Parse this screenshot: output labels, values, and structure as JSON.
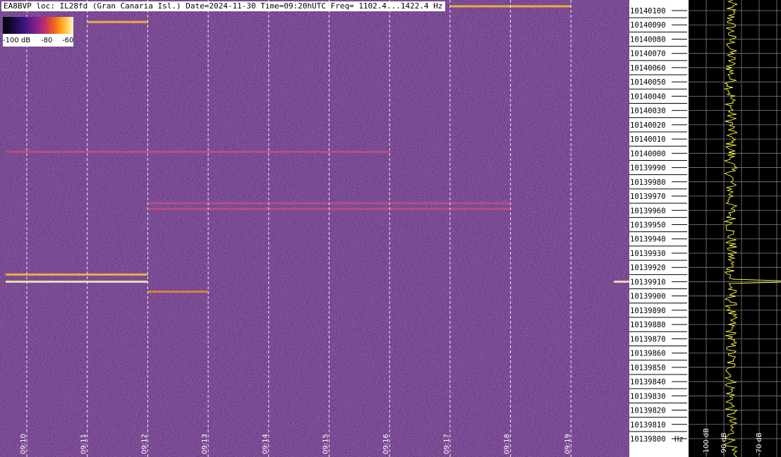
{
  "header": {
    "text": "EA8BVP loc: IL28fd (Gran Canaria Isl.) Date=2024-11-30 Time=09:20hUTC Freq= 1102.4...1422.4 Hz"
  },
  "colorbar": {
    "labels": [
      "-100 dB",
      "-80",
      "-60"
    ]
  },
  "chart_data": {
    "type": "heatmap",
    "title": "",
    "x": [
      "09:10",
      "09:11",
      "09:12",
      "09:13",
      "09:14",
      "09:15",
      "09:16",
      "09:17",
      "09:18",
      "09:19"
    ],
    "y_ticks": [
      10140100,
      10140090,
      10140080,
      10140070,
      10140060,
      10140050,
      10140040,
      10140030,
      10140020,
      10140010,
      10140000,
      10139990,
      10139980,
      10139970,
      10139960,
      10139950,
      10139940,
      10139930,
      10139920,
      10139910,
      10139900,
      10139890,
      10139880,
      10139870,
      10139860,
      10139850,
      10139840,
      10139830,
      10139820,
      10139810,
      10139800
    ],
    "y_unit": "Hz",
    "ylim": [
      10139795,
      10140103
    ],
    "color_range_db": [
      -100,
      -60
    ],
    "grid": true,
    "signals": [
      {
        "freq": 10140001,
        "t_start": "09:10",
        "t_end": "09:16",
        "level_db": -78
      },
      {
        "freq": 10139965,
        "t_start": "09:12",
        "t_end": "09:18",
        "level_db": -74
      },
      {
        "freq": 10139961,
        "t_start": "09:12",
        "t_end": "09:18",
        "level_db": -78
      },
      {
        "freq": 10139915,
        "t_start": "09:10",
        "t_end": "09:12",
        "level_db": -65
      },
      {
        "freq": 10139910,
        "t_start": "09:10",
        "t_end": "09:12",
        "level_db": -62
      },
      {
        "freq": 10139910,
        "t_start": "09:20",
        "t_end": "09:20",
        "level_db": -60
      },
      {
        "freq": 10140092,
        "t_start": "09:11",
        "t_end": "09:12",
        "level_db": -65
      },
      {
        "freq": 10139903,
        "t_start": "09:12",
        "t_end": "09:13",
        "level_db": -70
      },
      {
        "freq": 10140103,
        "t_start": "09:17",
        "t_end": "09:19",
        "level_db": -66
      }
    ],
    "spectrum": {
      "ticks_db": [
        "-100 dB",
        "-90 dB",
        "-70 dB"
      ],
      "xlim_db": [
        -110,
        -60
      ]
    }
  }
}
